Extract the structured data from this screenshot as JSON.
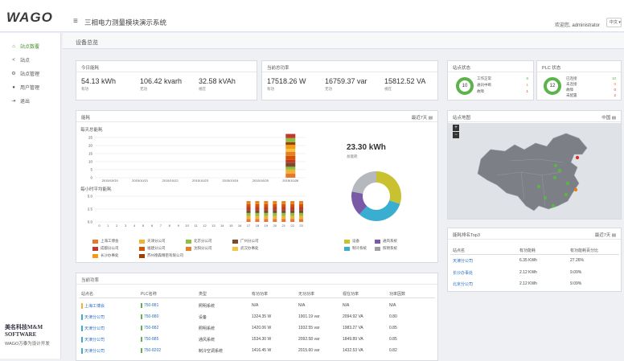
{
  "app": {
    "logo": "WAGO",
    "title": "三相电力测量模块演示系统",
    "user": "欢迎您, administrator",
    "lang": "中文"
  },
  "sidebar": {
    "items": [
      {
        "label": "站点数覆",
        "icon": "home-icon"
      },
      {
        "label": "站点",
        "icon": "share-icon"
      },
      {
        "label": "站点管理",
        "icon": "nodes-icon"
      },
      {
        "label": "用户管理",
        "icon": "users-icon"
      },
      {
        "label": "退出",
        "icon": "logout-icon"
      }
    ],
    "brand_name": "美名科技M&M SOFTWARE",
    "brand_sub": "WAGO万泰为设计开发"
  },
  "page": {
    "title": "设备总览"
  },
  "today": {
    "title": "今日能耗",
    "stats": [
      {
        "value": "54.13 kWh",
        "label": "有功"
      },
      {
        "value": "106.42 kvarh",
        "label": "无功"
      },
      {
        "value": "32.58 kVAh",
        "label": "视在"
      }
    ]
  },
  "power": {
    "title": "当前总功率",
    "stats": [
      {
        "value": "17518.26 W",
        "label": "有功"
      },
      {
        "value": "16759.37 var",
        "label": "无功"
      },
      {
        "value": "15812.52 VA",
        "label": "视在"
      }
    ]
  },
  "site_status": {
    "title": "站点状态",
    "ring": "10",
    "rows": [
      {
        "label": "工作正常",
        "value": "8"
      },
      {
        "label": "通讯中断",
        "value": "1"
      },
      {
        "label": "故障",
        "value": "1"
      }
    ]
  },
  "plc_status": {
    "title": "PLC 状态",
    "ring": "12",
    "rows": [
      {
        "label": "已连接",
        "value": "10"
      },
      {
        "label": "未连接",
        "value": "0"
      },
      {
        "label": "故障",
        "value": "0"
      },
      {
        "label": "未配置",
        "value": "2"
      }
    ]
  },
  "energy": {
    "title": "能耗",
    "range": "最近7天",
    "daily_title": "每天总能耗",
    "hourly_title": "每小时平均能耗",
    "total": "23.30 kWh",
    "total_label": "总能耗",
    "daily_y": [
      "25",
      "20",
      "15",
      "10",
      "5",
      "0"
    ],
    "daily_x": [
      "2015/10/20",
      "2015/10/21",
      "2015/10/22",
      "2015/10/23",
      "2015/10/24",
      "2015/10/25",
      "2015/10/26"
    ],
    "hourly_y": [
      "5.0",
      "2.5",
      "0.0"
    ],
    "hourly_x": [
      "0",
      "1",
      "2",
      "3",
      "4",
      "5",
      "6",
      "7",
      "8",
      "9",
      "10",
      "11",
      "12",
      "13",
      "14",
      "15",
      "16",
      "17",
      "18",
      "19",
      "20",
      "21",
      "22",
      "23"
    ],
    "legend_left": [
      {
        "label": "上海工博会",
        "color": "#e8772e"
      },
      {
        "label": "天津分公司",
        "color": "#f2b134"
      },
      {
        "label": "北京分公司",
        "color": "#8bbf3f"
      },
      {
        "label": "广州分公司",
        "color": "#7a4a2a"
      },
      {
        "label": "成都分公司",
        "color": "#c0392b"
      },
      {
        "label": "福建分公司",
        "color": "#d35400"
      },
      {
        "label": "沈阳分公司",
        "color": "#e67e22"
      },
      {
        "label": "武汉办事处",
        "color": "#f5c242"
      },
      {
        "label": "长沙办事处",
        "color": "#f39c12"
      },
      {
        "label": "苏州德森精密有限公司",
        "color": "#a04000"
      }
    ],
    "legend_right": [
      {
        "label": "设备",
        "color": "#c9c130"
      },
      {
        "label": "通风系统",
        "color": "#7a5aa6"
      },
      {
        "label": "制冷系统",
        "color": "#3aaed0"
      },
      {
        "label": "照明系统",
        "color": "#9aa0a6"
      }
    ],
    "donut": [
      {
        "name": "设备",
        "value": 30,
        "color": "#c9c130"
      },
      {
        "name": "制冷系统",
        "value": 32,
        "color": "#3aaed0"
      },
      {
        "name": "通风系统",
        "value": 16,
        "color": "#7a5aa6"
      },
      {
        "name": "照明系统",
        "value": 22,
        "color": "#b5b8bc"
      }
    ]
  },
  "current": {
    "title": "当前功率",
    "headers": [
      "站点名",
      "PLC名称",
      "类型",
      "有功功率",
      "无功功率",
      "视在功率",
      "功率因数"
    ],
    "rows": [
      [
        "上海工博会",
        "750-881",
        "照明系统",
        "N/A",
        "N/A",
        "N/A",
        "N/A"
      ],
      [
        "天津分公司",
        "750-880",
        "设备",
        "1324.35 W",
        "1901.19 var",
        "2094.92 VA",
        "0.80"
      ],
      [
        "天津分公司",
        "750-882",
        "照明系统",
        "1420.06 W",
        "1932.55 var",
        "1983.27 VA",
        "0.85"
      ],
      [
        "天津分公司",
        "750-885",
        "通风系统",
        "1534.30 W",
        "2092.58 var",
        "1849.89 VA",
        "0.85"
      ],
      [
        "天津分公司",
        "750-8202",
        "制冷空调系统",
        "1416.45 W",
        "2015.60 var",
        "1432.53 VA",
        "0.82"
      ]
    ]
  },
  "map": {
    "title": "站点地图",
    "range": "中国",
    "zoom_in": "+",
    "zoom_out": "−"
  },
  "top3": {
    "title": "能耗排名Top3",
    "range": "最近7天",
    "headers": [
      "站点名",
      "有功能耗",
      "有功能耗百分比"
    ],
    "rows": [
      [
        "天津分公司",
        "6.35 KWh",
        "27.26%"
      ],
      [
        "长沙办事处",
        "2.12 KWh",
        "9.09%"
      ],
      [
        "北京分公司",
        "2.12 KWh",
        "9.09%"
      ]
    ]
  }
}
